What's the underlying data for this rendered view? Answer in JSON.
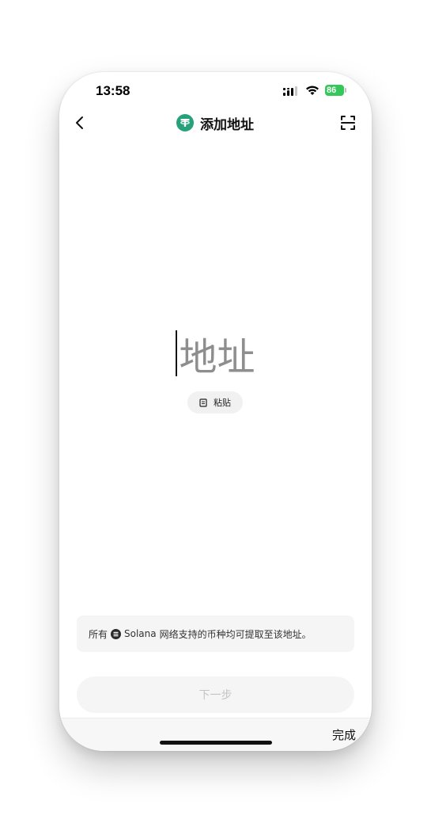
{
  "status_bar": {
    "time": "13:58",
    "battery_level": "86"
  },
  "header": {
    "title": "添加地址",
    "coin_icon": "tether-usdt-icon",
    "coin_color": "#26a17b"
  },
  "address_input": {
    "placeholder": "地址"
  },
  "paste_button": {
    "label": "粘贴"
  },
  "info": {
    "prefix": "所有",
    "network_icon": "solana-icon",
    "network_name": "Solana",
    "suffix": "网络支持的币种均可提取至该地址。"
  },
  "next_button": {
    "label": "下一步"
  },
  "keyboard_toolbar": {
    "done_label": "完成"
  },
  "colors": {
    "battery": "#34c759",
    "placeholder_text": "#8e8e8e",
    "disabled_button_text": "#c4c4c4"
  }
}
